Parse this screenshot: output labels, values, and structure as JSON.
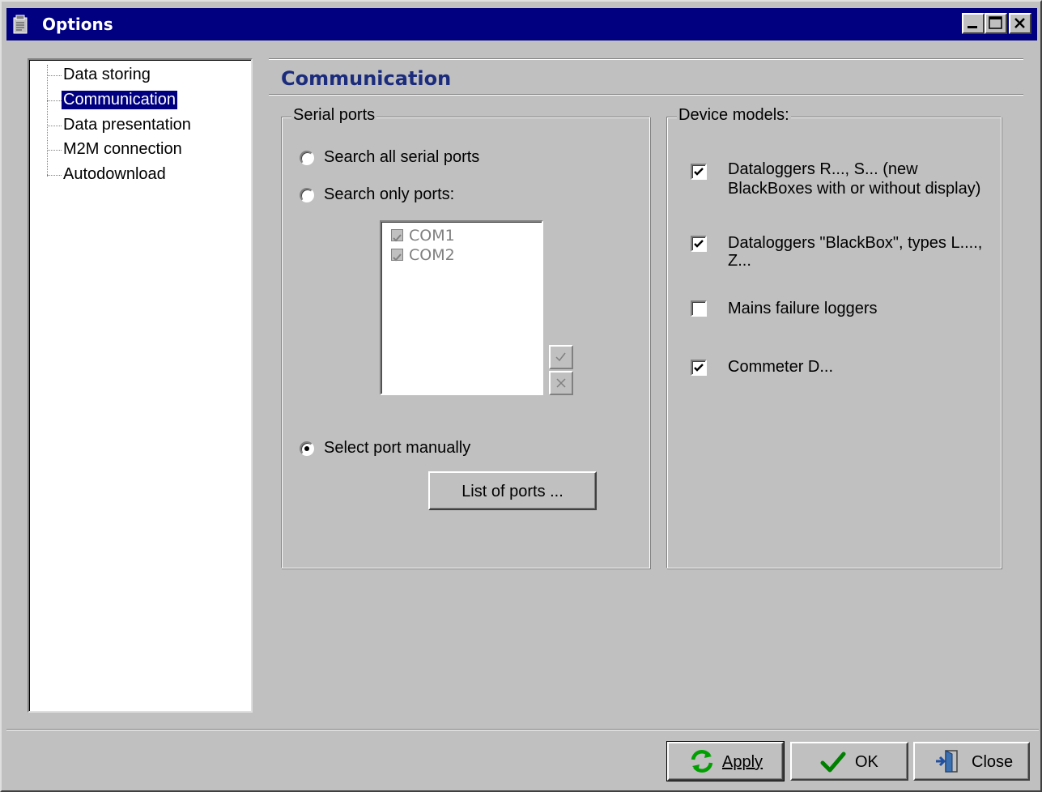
{
  "window": {
    "title": "Options",
    "controls": {
      "minimize": "minimize",
      "maximize": "maximize",
      "close": "close"
    }
  },
  "tree": {
    "items": [
      {
        "label": "Data storing",
        "selected": false
      },
      {
        "label": "Communication",
        "selected": true
      },
      {
        "label": "Data presentation",
        "selected": false
      },
      {
        "label": "M2M connection",
        "selected": false
      },
      {
        "label": "Autodownload",
        "selected": false
      }
    ]
  },
  "section": {
    "title": "Communication"
  },
  "serial_ports": {
    "caption": "Serial ports",
    "options": [
      {
        "label": "Search all serial ports",
        "checked": false
      },
      {
        "label": "Search only ports:",
        "checked": false
      },
      {
        "label": "Select port manually",
        "checked": true
      }
    ],
    "ports": [
      {
        "label": "COM1",
        "checked": true
      },
      {
        "label": "COM2",
        "checked": true
      }
    ],
    "list_button": "List of ports ..."
  },
  "device_models": {
    "caption": "Device models:",
    "items": [
      {
        "line1": "Dataloggers R..., S... (new",
        "line2": "BlackBoxes with or without display)",
        "checked": true
      },
      {
        "line1": "Dataloggers \"BlackBox\", types L....,",
        "line2": "Z...",
        "checked": true
      },
      {
        "line1": "Mains failure loggers",
        "line2": "",
        "checked": false
      },
      {
        "line1": "Commeter D...",
        "line2": "",
        "checked": true
      }
    ]
  },
  "buttons": {
    "apply": "Apply",
    "ok": "OK",
    "close": "Close"
  },
  "icons": {
    "title": "clipboard-icon",
    "apply": "refresh-icon",
    "ok": "checkmark-icon",
    "close": "door-exit-icon"
  },
  "colors": {
    "titlebar": "#000080",
    "face": "#c0c0c0",
    "section_title": "#1c2c7c",
    "ok_check": "#008000",
    "apply_icon": "#00a000"
  }
}
